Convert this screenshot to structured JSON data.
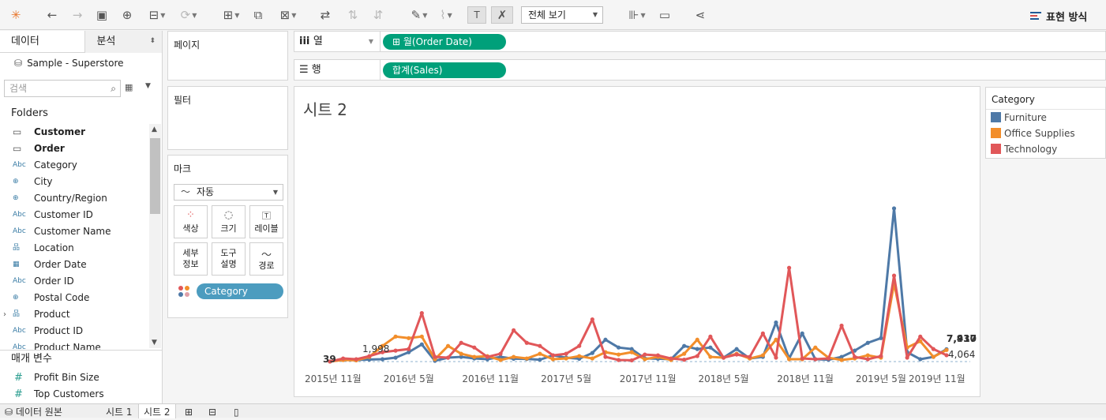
{
  "toolbar": {
    "view_dropdown": "전체 보기",
    "show_me": "표현 방식"
  },
  "data_pane": {
    "tab_data": "데이터",
    "tab_analytics": "분석",
    "datasource": "Sample - Superstore",
    "search_placeholder": "검색",
    "folders_label": "Folders",
    "fields": [
      {
        "icon": "folder-icon",
        "glyph": "▭",
        "label": "Customer",
        "bold": true
      },
      {
        "icon": "folder-icon",
        "glyph": "▭",
        "label": "Order",
        "bold": true
      },
      {
        "icon": "abc-icon",
        "glyph": "Abc",
        "label": "Category"
      },
      {
        "icon": "globe-icon",
        "glyph": "⊕",
        "label": "City"
      },
      {
        "icon": "globe-icon",
        "glyph": "⊕",
        "label": "Country/Region"
      },
      {
        "icon": "abc-icon",
        "glyph": "Abc",
        "label": "Customer ID"
      },
      {
        "icon": "abc-icon",
        "glyph": "Abc",
        "label": "Customer Name"
      },
      {
        "icon": "hierarchy-icon",
        "glyph": "品",
        "label": "Location"
      },
      {
        "icon": "calendar-icon",
        "glyph": "▦",
        "label": "Order Date"
      },
      {
        "icon": "abc-icon",
        "glyph": "Abc",
        "label": "Order ID"
      },
      {
        "icon": "globe-icon",
        "glyph": "⊕",
        "label": "Postal Code"
      },
      {
        "icon": "hierarchy-icon",
        "glyph": "品",
        "label": "Product",
        "expand": true
      },
      {
        "icon": "abc-icon",
        "glyph": "Abc",
        "label": "Product ID"
      },
      {
        "icon": "abc-icon",
        "glyph": "Abc",
        "label": "Product Name"
      }
    ],
    "measures_label": "매개 변수",
    "parameters": [
      "Profit Bin Size",
      "Top Customers"
    ]
  },
  "cards": {
    "pages": "페이지",
    "filters": "필터",
    "marks": "마크",
    "mark_type": "자동",
    "mark_buttons": {
      "color": "색상",
      "size": "크기",
      "label": "레이블",
      "detail": [
        "세부",
        "정보"
      ],
      "tooltip": [
        "도구",
        "설명"
      ],
      "path": "경로"
    },
    "mark_pill": "Category"
  },
  "shelves": {
    "columns_label": "열",
    "columns_pill": "월(Order Date)",
    "rows_label": "행",
    "rows_pill": "합계(Sales)"
  },
  "colors": {
    "furniture": "#4e79a7",
    "office": "#f28e2b",
    "technology": "#e15759",
    "pill_green": "#00a07a",
    "pill_teal": "#4c9cbf"
  },
  "sheet": {
    "title": "시트 2"
  },
  "legend": {
    "title": "Category",
    "items": [
      {
        "label": "Furniture",
        "color": "#4e79a7"
      },
      {
        "label": "Office Supplies",
        "color": "#f28e2b"
      },
      {
        "label": "Technology",
        "color": "#e15759"
      }
    ]
  },
  "chart_data": {
    "type": "line",
    "title": "시트 2",
    "xlabel": "",
    "ylabel": "",
    "x_ticks": [
      "2015년 11월",
      "2016년 5월",
      "2016년 11월",
      "2017년 5월",
      "2017년 11월",
      "2018년 5월",
      "2018년 11월",
      "2019년 5월",
      "2019년 11월"
    ],
    "x_range": [
      "2015-11",
      "2019-12"
    ],
    "ylim": [
      0,
      100000
    ],
    "grid": false,
    "data_labels": [
      "39",
      "1,998",
      "7,930",
      "7,417",
      "4,064"
    ],
    "series": [
      {
        "name": "Furniture",
        "color": "#4e79a7",
        "values": [
          39,
          1200,
          1000,
          1300,
          1500,
          2500,
          6000,
          11000,
          500,
          2500,
          3000,
          2000,
          1500,
          3000,
          1800,
          1700,
          1200,
          4000,
          2500,
          1800,
          5500,
          14000,
          9000,
          8000,
          2000,
          1800,
          1500,
          10000,
          8000,
          9000,
          2500,
          8000,
          2000,
          3000,
          25000,
          2000,
          18000,
          1500,
          1200,
          3000,
          7000,
          12000,
          15000,
          98000,
          6000,
          1500,
          3000,
          7930
        ]
      },
      {
        "name": "Office Supplies",
        "color": "#f28e2b",
        "values": [
          39,
          1000,
          800,
          3000,
          10000,
          16000,
          15000,
          16000,
          1500,
          10000,
          5000,
          3000,
          3500,
          1000,
          3000,
          2000,
          5000,
          1500,
          2000,
          3500,
          2000,
          6000,
          4500,
          6000,
          1500,
          3000,
          1000,
          5000,
          14000,
          3000,
          2500,
          5000,
          2000,
          4000,
          14000,
          1500,
          1500,
          9000,
          2500,
          1000,
          2000,
          4000,
          2500,
          50000,
          9000,
          13000,
          3000,
          7417
        ]
      },
      {
        "name": "Technology",
        "color": "#e15759",
        "values": [
          39,
          1998,
          1500,
          3500,
          6000,
          7000,
          8000,
          31000,
          3000,
          2500,
          12000,
          9000,
          3000,
          5000,
          20000,
          12000,
          10000,
          4000,
          5000,
          10000,
          27000,
          3000,
          1000,
          800,
          4500,
          4000,
          2000,
          1200,
          3500,
          16000,
          2500,
          4500,
          3000,
          18000,
          2500,
          60000,
          2000,
          1500,
          2000,
          23000,
          3000,
          1500,
          3500,
          55000,
          2500,
          16000,
          8000,
          4064
        ]
      }
    ]
  },
  "bottom_tabs": {
    "datasource": "데이터 원본",
    "sheet1": "시트 1",
    "sheet2": "시트 2"
  }
}
